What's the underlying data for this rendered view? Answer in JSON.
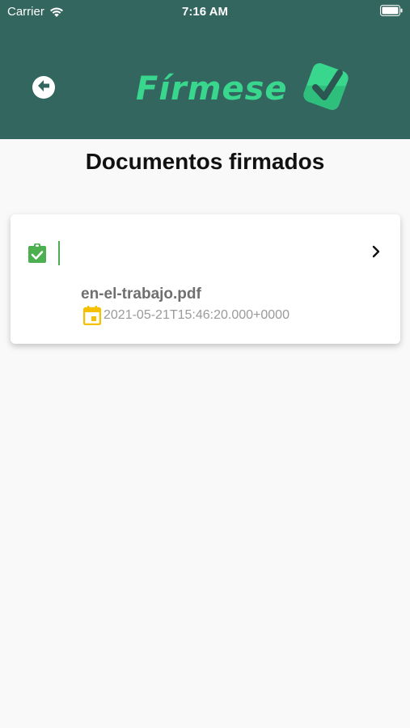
{
  "status_bar": {
    "carrier": "Carrier",
    "time": "7:16 AM"
  },
  "header": {
    "logo_text": "Fírmese",
    "background_color": "#346660",
    "accent_color": "#39d68e"
  },
  "page": {
    "title": "Documentos firmados"
  },
  "documents": [
    {
      "title": "",
      "file_name": "en-el-trabajo.pdf",
      "date": "2021-05-21T15:46:20.000+0000",
      "status_icon": "clipboard-check-icon",
      "status_color": "#4caf50",
      "date_icon": "calendar-icon",
      "date_icon_color": "#f6c000"
    }
  ]
}
